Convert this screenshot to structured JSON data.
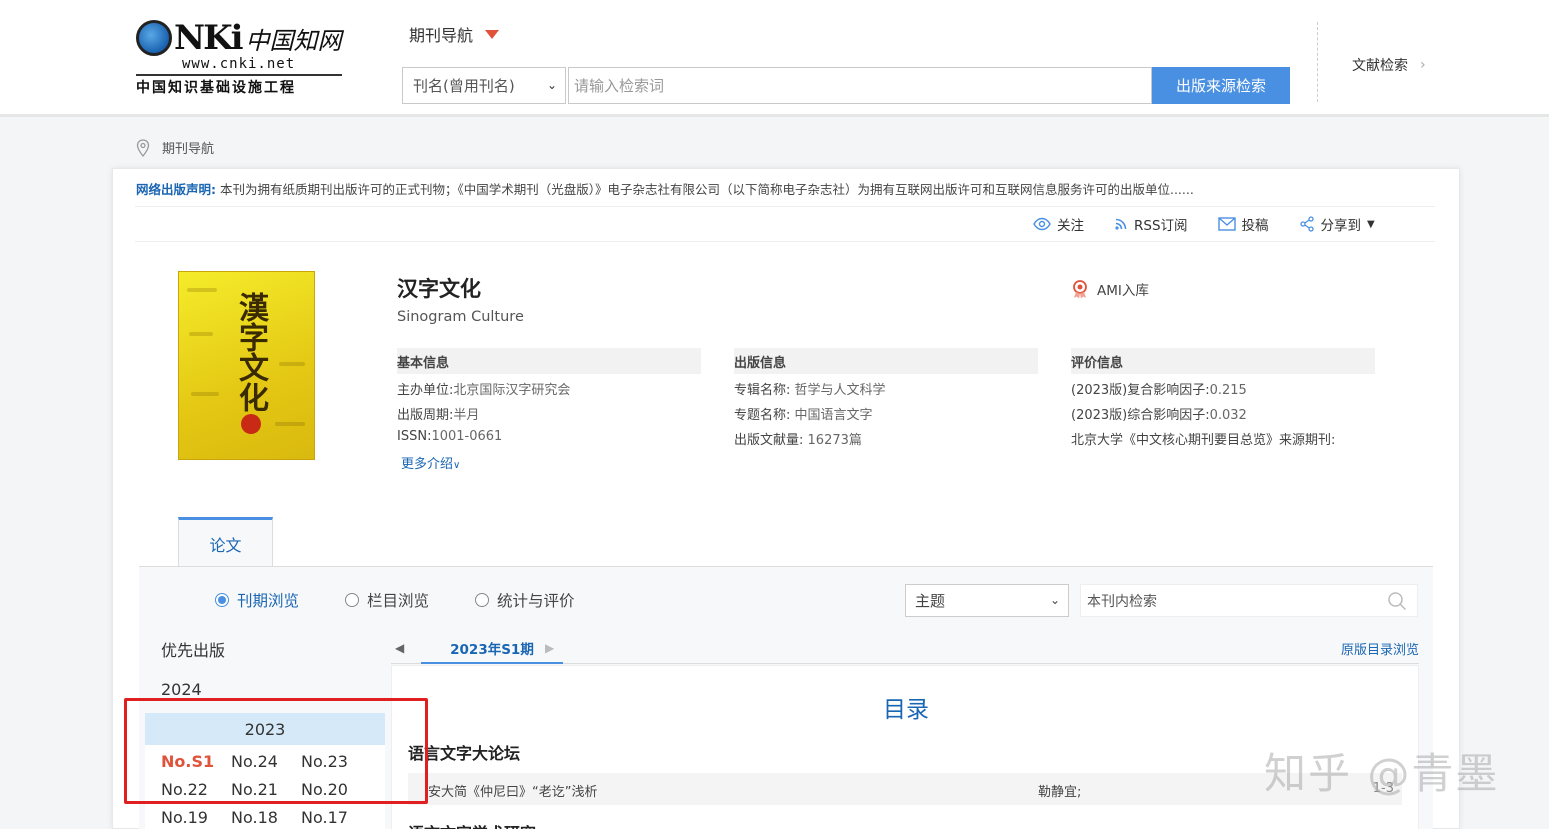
{
  "logo": {
    "brand": "NKi",
    "cn_name": "中国知网",
    "url": "www.cnki.net",
    "subtitle": "中国知识基础设施工程"
  },
  "header": {
    "nav_title": "期刊导航",
    "search_field": "刊名(曾用刊名)",
    "search_placeholder": "请输入检索词",
    "search_button": "出版来源检索",
    "doc_search": "文献检索"
  },
  "breadcrumb": {
    "label": "期刊导航"
  },
  "notice": {
    "label": "网络出版声明:",
    "text": "本刊为拥有纸质期刊出版许可的正式刊物；《中国学术期刊（光盘版）》电子杂志社有限公司（以下简称电子杂志社）为拥有互联网出版许可和互联网信息服务许可的出版单位......"
  },
  "actions": [
    {
      "label": "关注",
      "icon": "eye-icon"
    },
    {
      "label": "RSS订阅",
      "icon": "rss-icon"
    },
    {
      "label": "投稿",
      "icon": "mail-icon"
    },
    {
      "label": "分享到",
      "icon": "share-icon"
    }
  ],
  "journal": {
    "title": "汉字文化",
    "english_title": "Sinogram Culture",
    "badge": "AMI入库",
    "cover_text": "漢字文化"
  },
  "basic_info": {
    "heading": "基本信息",
    "rows": [
      {
        "key": "主办单位:",
        "value": "北京国际汉字研究会"
      },
      {
        "key": "出版周期:",
        "value": "半月"
      },
      {
        "key": "ISSN:",
        "value": "1001-0661"
      }
    ],
    "more": "更多介绍"
  },
  "publish_info": {
    "heading": "出版信息",
    "rows": [
      {
        "key": "专辑名称:",
        "value": "哲学与人文科学"
      },
      {
        "key": "专题名称:",
        "value": "中国语言文字"
      },
      {
        "key": "出版文献量:",
        "value": "16273篇"
      }
    ]
  },
  "eval_info": {
    "heading": "评价信息",
    "rows": [
      {
        "key": "(2023版)复合影响因子:",
        "value": "0.215"
      },
      {
        "key": "(2023版)综合影响因子:",
        "value": "0.032"
      },
      {
        "key": "北京大学《中文核心期刊要目总览》来源期刊:",
        "value": ""
      }
    ]
  },
  "tab": {
    "label": "论文"
  },
  "browse_modes": [
    {
      "label": "刊期浏览",
      "selected": true
    },
    {
      "label": "栏目浏览",
      "selected": false
    },
    {
      "label": "统计与评价",
      "selected": false
    }
  ],
  "topic_select": "主题",
  "in_journal_search": "本刊内检索",
  "years": {
    "priority": "优先出版",
    "y2024": "2024",
    "y2023": "2023",
    "issues": [
      "No.S1",
      "No.24",
      "No.23",
      "No.22",
      "No.21",
      "No.20",
      "No.19",
      "No.18",
      "No.17"
    ],
    "selected_issue": "No.S1"
  },
  "issue_tab": {
    "current": "2023年S1期",
    "original_toc": "原版目录浏览"
  },
  "toc": {
    "title": "目录",
    "section1": "语言文字大论坛",
    "row1": {
      "title": "安大简《仲尼曰》“老讫”浅析",
      "author": "勒静宜;",
      "pages": "1-3"
    },
    "section2": "语言文字学术研究"
  },
  "watermark": "知乎 @青墨",
  "colors": {
    "accent": "#4a90e2",
    "link": "#1a66b3",
    "highlight": "#e0523a",
    "annotation_box": "#e02020"
  }
}
